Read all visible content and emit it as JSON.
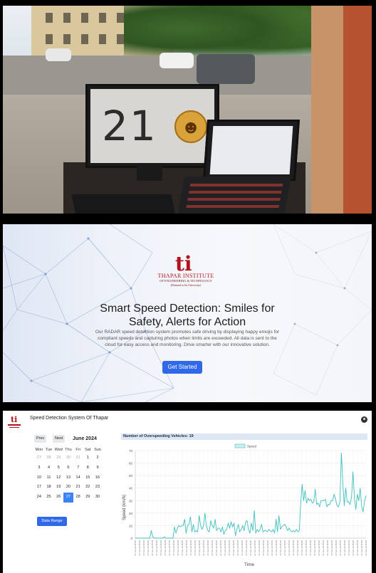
{
  "photo": {
    "monitor_number": "21",
    "emoji_face": "☻"
  },
  "landing": {
    "logo": {
      "mark": "ti",
      "name": "THAPAR INSTITUTE",
      "sub": "OF ENGINEERING & TECHNOLOGY",
      "sub2": "(Deemed to be University)"
    },
    "title": "Smart Speed Detection: Smiles for Safety, Alerts for Action",
    "description": "Our RADAR speed detection system promotes safe driving by displaying happy emojis for compliant speeds and capturing photos when limits are exceeded. All data is sent to the cloud for easy access and monitoring. Drive smarter with our innovative solution.",
    "cta": "Get Started"
  },
  "dashboard": {
    "title": "Speed Detection System Of Thapar",
    "calendar": {
      "prev_label": "Prev",
      "next_label": "Next",
      "month": "June 2024",
      "weekdays": [
        "Mon",
        "Tue",
        "Wed",
        "Thu",
        "Fri",
        "Sat",
        "Sun"
      ],
      "weeks": [
        [
          "27",
          "28",
          "29",
          "30",
          "31",
          "1",
          "2"
        ],
        [
          "3",
          "4",
          "5",
          "6",
          "7",
          "8",
          "9"
        ],
        [
          "10",
          "11",
          "12",
          "13",
          "14",
          "15",
          "16"
        ],
        [
          "17",
          "18",
          "19",
          "20",
          "21",
          "22",
          "23"
        ],
        [
          "24",
          "25",
          "26",
          "27",
          "28",
          "29",
          "30"
        ]
      ],
      "muted_cells": [
        "0-0",
        "0-1",
        "0-2",
        "0-3",
        "0-4"
      ],
      "selected_cell": "4-3",
      "range_button": "Data Range"
    },
    "overspeeding_label": "Number of Overspeeding Vehicles: 19"
  },
  "chart_data": {
    "type": "line",
    "series": [
      {
        "name": "Speed",
        "color": "#3fbfbf",
        "values": [
          0,
          0,
          0,
          0,
          0,
          0,
          0,
          0,
          0,
          0,
          0,
          6,
          1,
          0,
          0,
          0,
          0,
          0,
          0,
          0,
          1,
          0,
          0,
          0,
          0,
          0,
          0,
          9,
          4,
          8,
          10,
          9,
          10,
          10,
          15,
          4,
          10,
          11,
          17,
          5,
          11,
          5,
          6,
          5,
          18,
          10,
          7,
          10,
          20,
          10,
          6,
          5,
          14,
          10,
          8,
          15,
          6,
          8,
          8,
          5,
          9,
          3,
          6,
          7,
          12,
          8,
          13,
          9,
          12,
          2,
          7,
          11,
          5,
          7,
          10,
          6,
          13,
          14,
          7,
          4,
          12,
          6,
          22,
          4,
          7,
          5,
          7,
          11,
          5,
          6,
          6,
          5,
          7,
          6,
          5,
          7,
          4,
          15,
          5,
          18,
          7,
          9,
          10,
          11,
          9,
          6,
          8,
          6,
          5,
          6,
          5,
          7,
          5,
          6,
          28,
          43,
          30,
          38,
          28,
          32,
          30,
          31,
          28,
          29,
          39,
          27,
          28,
          25,
          30,
          30,
          30,
          31,
          25,
          27,
          27,
          30,
          30,
          35,
          31,
          26,
          25,
          29,
          68,
          44,
          26,
          40,
          29,
          29,
          27,
          33,
          53,
          32,
          23,
          35,
          30,
          40,
          25,
          21,
          30,
          34
        ]
      }
    ],
    "ylabel": "Speed (km/h)",
    "xlabel": "Time",
    "ylim": [
      0,
      70
    ],
    "yticks": [
      0,
      10,
      20,
      30,
      40,
      50,
      60,
      70
    ],
    "xtick_label": "27 Jun 12:15:25",
    "legend": "top-center",
    "grid": true
  }
}
